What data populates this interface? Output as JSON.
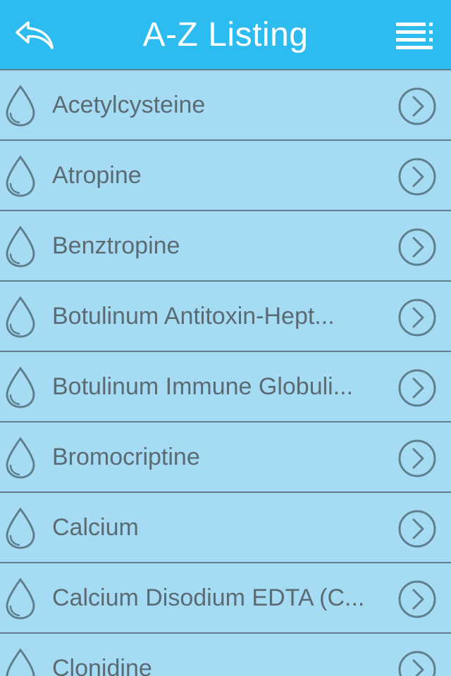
{
  "header": {
    "title": "A-Z Listing",
    "back_icon": "reply-arrow-icon",
    "menu_icon": "list-menu-icon",
    "background": "#2cbcef"
  },
  "list": {
    "item_icon": "droplet-icon",
    "accessory_icon": "chevron-right-circle-icon",
    "items": [
      {
        "label": "Acetylcysteine"
      },
      {
        "label": "Atropine"
      },
      {
        "label": "Benztropine"
      },
      {
        "label": "Botulinum Antitoxin-Hept..."
      },
      {
        "label": "Botulinum Immune Globuli..."
      },
      {
        "label": "Bromocriptine"
      },
      {
        "label": "Calcium"
      },
      {
        "label": "Calcium Disodium EDTA (C..."
      },
      {
        "label": "Clonidine"
      }
    ]
  },
  "colors": {
    "row_background": "#a5dcf4",
    "text": "#5b6b73",
    "divider": "#5f7f8f"
  }
}
